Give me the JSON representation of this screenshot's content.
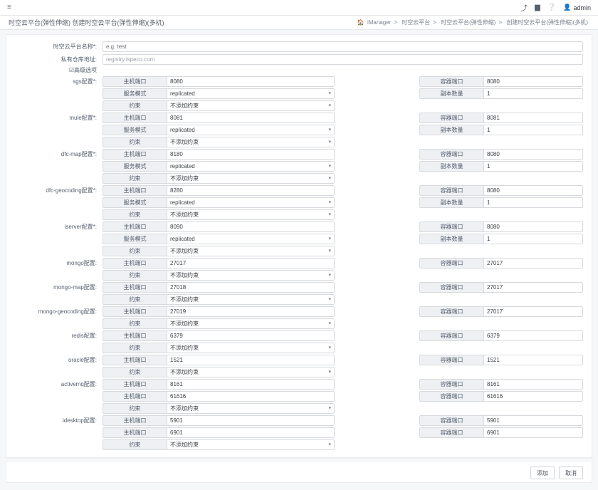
{
  "topbar": {
    "hamburger": "≡",
    "admin_label": "admin"
  },
  "subbar": {
    "title": "时空云平台(弹性伸缩) 创建时空云平台(弹性伸缩)(多机)",
    "crumbs": [
      "iManager",
      "时空云平台",
      "时空云平台(弹性伸缩)",
      "创建时空云平台(弹性伸缩)(多机)"
    ],
    "home_icon": "🏠"
  },
  "form": {
    "name_label": "时空云平台名称*:",
    "name_placeholder": "e.g. test",
    "repo_label": "私有仓库地址:",
    "repo_value": "registry.ispeco.com",
    "adv_label": "☑高级选项"
  },
  "labels": {
    "host_port": "主机端口",
    "service_mode": "服务模式",
    "constraint": "约束",
    "container_port": "容器端口",
    "replica_count": "副本数量"
  },
  "options": {
    "replicated": "replicated",
    "no_constraint": "不添加约束"
  },
  "sections": [
    {
      "id": "sgs",
      "label": "sgs配置*:",
      "lines": [
        {
          "left": {
            "k": "host_port",
            "t": "input",
            "v": "8080"
          },
          "right": {
            "k": "container_port",
            "t": "input",
            "v": "8080"
          }
        },
        {
          "left": {
            "k": "service_mode",
            "t": "select",
            "v": "replicated"
          },
          "right": {
            "k": "replica_count",
            "t": "input",
            "v": "1"
          }
        },
        {
          "left": {
            "k": "constraint",
            "t": "select",
            "v": "no_constraint"
          }
        }
      ]
    },
    {
      "id": "mule",
      "label": "mule配置*:",
      "lines": [
        {
          "left": {
            "k": "host_port",
            "t": "input",
            "v": "8081"
          },
          "right": {
            "k": "container_port",
            "t": "input",
            "v": "8081"
          }
        },
        {
          "left": {
            "k": "service_mode",
            "t": "select",
            "v": "replicated"
          },
          "right": {
            "k": "replica_count",
            "t": "input",
            "v": "1"
          }
        },
        {
          "left": {
            "k": "constraint",
            "t": "select",
            "v": "no_constraint"
          }
        }
      ]
    },
    {
      "id": "dfc-map",
      "label": "dfc-map配置*:",
      "lines": [
        {
          "left": {
            "k": "host_port",
            "t": "input",
            "v": "8180"
          },
          "right": {
            "k": "container_port",
            "t": "input",
            "v": "8080"
          }
        },
        {
          "left": {
            "k": "service_mode",
            "t": "select",
            "v": "replicated"
          },
          "right": {
            "k": "replica_count",
            "t": "input",
            "v": "1"
          }
        },
        {
          "left": {
            "k": "constraint",
            "t": "select",
            "v": "no_constraint"
          }
        }
      ]
    },
    {
      "id": "dfc-geocoding",
      "label": "dfc-geocoding配置*:",
      "lines": [
        {
          "left": {
            "k": "host_port",
            "t": "input",
            "v": "8280"
          },
          "right": {
            "k": "container_port",
            "t": "input",
            "v": "8080"
          }
        },
        {
          "left": {
            "k": "service_mode",
            "t": "select",
            "v": "replicated"
          },
          "right": {
            "k": "replica_count",
            "t": "input",
            "v": "1"
          }
        },
        {
          "left": {
            "k": "constraint",
            "t": "select",
            "v": "no_constraint"
          }
        }
      ]
    },
    {
      "id": "iserver",
      "label": "iserver配置*:",
      "lines": [
        {
          "left": {
            "k": "host_port",
            "t": "input",
            "v": "8090"
          },
          "right": {
            "k": "container_port",
            "t": "input",
            "v": "8080"
          }
        },
        {
          "left": {
            "k": "service_mode",
            "t": "select",
            "v": "replicated"
          },
          "right": {
            "k": "replica_count",
            "t": "input",
            "v": "1"
          }
        },
        {
          "left": {
            "k": "constraint",
            "t": "select",
            "v": "no_constraint"
          }
        }
      ]
    },
    {
      "id": "mongo",
      "label": "mongo配置:",
      "lines": [
        {
          "left": {
            "k": "host_port",
            "t": "input",
            "v": "27017"
          },
          "right": {
            "k": "container_port",
            "t": "input",
            "v": "27017"
          }
        },
        {
          "left": {
            "k": "constraint",
            "t": "select",
            "v": "no_constraint"
          }
        }
      ]
    },
    {
      "id": "mongo-map",
      "label": "mongo-map配置:",
      "lines": [
        {
          "left": {
            "k": "host_port",
            "t": "input",
            "v": "27018"
          },
          "right": {
            "k": "container_port",
            "t": "input",
            "v": "27017"
          }
        },
        {
          "left": {
            "k": "constraint",
            "t": "select",
            "v": "no_constraint"
          }
        }
      ]
    },
    {
      "id": "mongo-geocoding",
      "label": "mongo-geocoding配置:",
      "lines": [
        {
          "left": {
            "k": "host_port",
            "t": "input",
            "v": "27019"
          },
          "right": {
            "k": "container_port",
            "t": "input",
            "v": "27017"
          }
        },
        {
          "left": {
            "k": "constraint",
            "t": "select",
            "v": "no_constraint"
          }
        }
      ]
    },
    {
      "id": "redis",
      "label": "redis配置:",
      "lines": [
        {
          "left": {
            "k": "host_port",
            "t": "input",
            "v": "6379"
          },
          "right": {
            "k": "container_port",
            "t": "input",
            "v": "6379"
          }
        },
        {
          "left": {
            "k": "constraint",
            "t": "select",
            "v": "no_constraint"
          }
        }
      ]
    },
    {
      "id": "oracle",
      "label": "oracle配置:",
      "lines": [
        {
          "left": {
            "k": "host_port",
            "t": "input",
            "v": "1521"
          },
          "right": {
            "k": "container_port",
            "t": "input",
            "v": "1521"
          }
        },
        {
          "left": {
            "k": "constraint",
            "t": "select",
            "v": "no_constraint"
          }
        }
      ]
    },
    {
      "id": "activemq",
      "label": "activemq配置:",
      "lines": [
        {
          "left": {
            "k": "host_port",
            "t": "input",
            "v": "8161"
          },
          "right": {
            "k": "container_port",
            "t": "input",
            "v": "8161"
          }
        },
        {
          "left": {
            "k": "host_port",
            "t": "input",
            "v": "61616"
          },
          "right": {
            "k": "container_port",
            "t": "input",
            "v": "61616"
          }
        },
        {
          "left": {
            "k": "constraint",
            "t": "select",
            "v": "no_constraint"
          }
        }
      ]
    },
    {
      "id": "idesktop",
      "label": "idesktop配置:",
      "lines": [
        {
          "left": {
            "k": "host_port",
            "t": "input",
            "v": "5901"
          },
          "right": {
            "k": "container_port",
            "t": "input",
            "v": "5901"
          }
        },
        {
          "left": {
            "k": "host_port",
            "t": "input",
            "v": "6901"
          },
          "right": {
            "k": "container_port",
            "t": "input",
            "v": "6901"
          }
        },
        {
          "left": {
            "k": "constraint",
            "t": "select",
            "v": "no_constraint"
          }
        }
      ]
    }
  ],
  "footer": {
    "add": "添加",
    "cancel": "取消"
  }
}
